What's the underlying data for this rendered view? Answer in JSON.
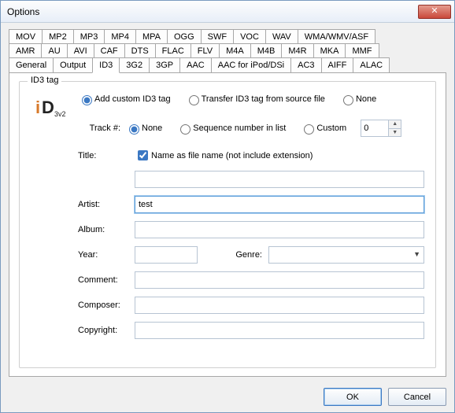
{
  "window": {
    "title": "Options"
  },
  "tabs": {
    "row1": [
      "MOV",
      "MP2",
      "MP3",
      "MP4",
      "MPA",
      "OGG",
      "SWF",
      "VOC",
      "WAV",
      "WMA/WMV/ASF"
    ],
    "row2": [
      "AMR",
      "AU",
      "AVI",
      "CAF",
      "DTS",
      "FLAC",
      "FLV",
      "M4A",
      "M4B",
      "M4R",
      "MKA",
      "MMF"
    ],
    "row3": [
      "General",
      "Output",
      "ID3",
      "3G2",
      "3GP",
      "AAC",
      "AAC for iPod/DSi",
      "AC3",
      "AIFF",
      "ALAC"
    ],
    "active": "ID3"
  },
  "fieldset": {
    "legend": "ID3 tag"
  },
  "modes": {
    "add": "Add custom ID3 tag",
    "transfer": "Transfer ID3 tag from source file",
    "none": "None",
    "selected": "add"
  },
  "track": {
    "label": "Track #:",
    "none": "None",
    "seq": "Sequence number in list",
    "custom": "Custom",
    "selected": "none",
    "spin_value": "0"
  },
  "title_row": {
    "label": "Title:",
    "checkbox": "Name as file name (not include extension)",
    "checked": true,
    "value": ""
  },
  "artist": {
    "label": "Artist:",
    "value": "test"
  },
  "album": {
    "label": "Album:",
    "value": ""
  },
  "year": {
    "label": "Year:",
    "value": ""
  },
  "genre": {
    "label": "Genre:",
    "value": ""
  },
  "comment": {
    "label": "Comment:",
    "value": ""
  },
  "composer": {
    "label": "Composer:",
    "value": ""
  },
  "copyright": {
    "label": "Copyright:",
    "value": ""
  },
  "buttons": {
    "ok": "OK",
    "cancel": "Cancel"
  }
}
